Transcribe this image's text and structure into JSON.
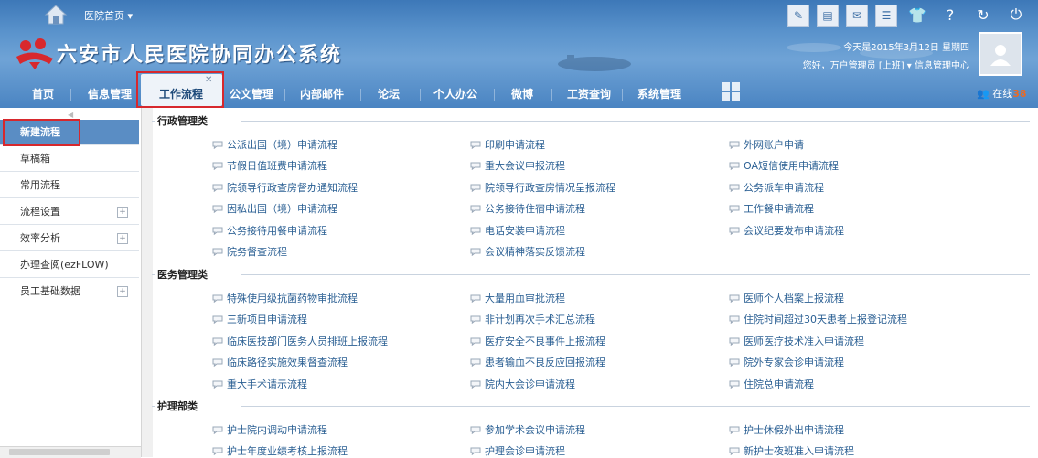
{
  "topbar": {
    "home_label": "医院首页 ▾"
  },
  "header": {
    "title": "六安市人民医院协同办公系统",
    "date": "今天是2015年3月12日 星期四",
    "user_greeting": "您好，万户管理员 [上班] ▾  信息管理中心",
    "online_label": "在线",
    "online_count": "38"
  },
  "nav": {
    "items": [
      "首页",
      "信息管理",
      "工作流程",
      "公文管理",
      "内部邮件",
      "论坛",
      "个人办公",
      "微博",
      "工资查询",
      "系统管理"
    ],
    "active": "工作流程"
  },
  "sidebar": {
    "items": [
      "新建流程",
      "草稿箱",
      "常用流程",
      "流程设置",
      "效率分析",
      "办理查阅(ezFLOW)",
      "员工基础数据"
    ]
  },
  "sections": [
    {
      "title": "行政管理类",
      "rows": [
        [
          "公派出国（境）申请流程",
          "印刷申请流程",
          "外网账户申请"
        ],
        [
          "节假日值班费申请流程",
          "重大会议申报流程",
          "OA短信使用申请流程"
        ],
        [
          "院领导行政查房督办通知流程",
          "院领导行政查房情况呈报流程",
          "公务派车申请流程"
        ],
        [
          "因私出国（境）申请流程",
          "公务接待住宿申请流程",
          "工作餐申请流程"
        ],
        [
          "公务接待用餐申请流程",
          "电话安装申请流程",
          "会议纪要发布申请流程"
        ],
        [
          "院务督查流程",
          "会议精神落实反馈流程",
          ""
        ]
      ]
    },
    {
      "title": "医务管理类",
      "rows": [
        [
          "特殊使用级抗菌药物审批流程",
          "大量用血审批流程",
          "医师个人档案上报流程"
        ],
        [
          "三新项目申请流程",
          "非计划再次手术汇总流程",
          "住院时间超过30天患者上报登记流程"
        ],
        [
          "临床医技部门医务人员排班上报流程",
          "医疗安全不良事件上报流程",
          "医师医疗技术准入申请流程"
        ],
        [
          "临床路径实施效果督查流程",
          "患者输血不良反应回报流程",
          "院外专家会诊申请流程"
        ],
        [
          "重大手术请示流程",
          "院内大会诊申请流程",
          "住院总申请流程"
        ]
      ]
    },
    {
      "title": "护理部类",
      "rows": [
        [
          "护士院内调动申请流程",
          "参加学术会议申请流程",
          "护士休假外出申请流程"
        ],
        [
          "护士年度业绩考核上报流程",
          "护理会诊申请流程",
          "新护士夜班准入申请流程"
        ]
      ]
    }
  ]
}
